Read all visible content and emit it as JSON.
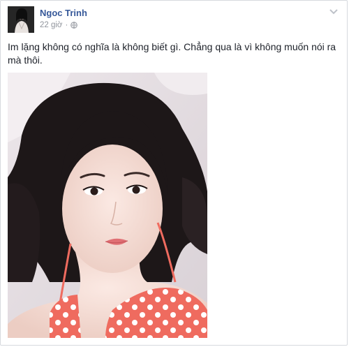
{
  "post": {
    "author": "Ngoc Trinh",
    "time": "22 giờ",
    "separator": "·",
    "text": "Im lặng không có nghĩa là không biết gì. Chẳng qua là vì không muốn nói ra mà thôi."
  },
  "icons": {
    "privacy": "globe-icon",
    "options": "chevron-down-icon"
  },
  "colors": {
    "author_link": "#365899",
    "meta_text": "#90949c",
    "body_text": "#1d2129"
  }
}
